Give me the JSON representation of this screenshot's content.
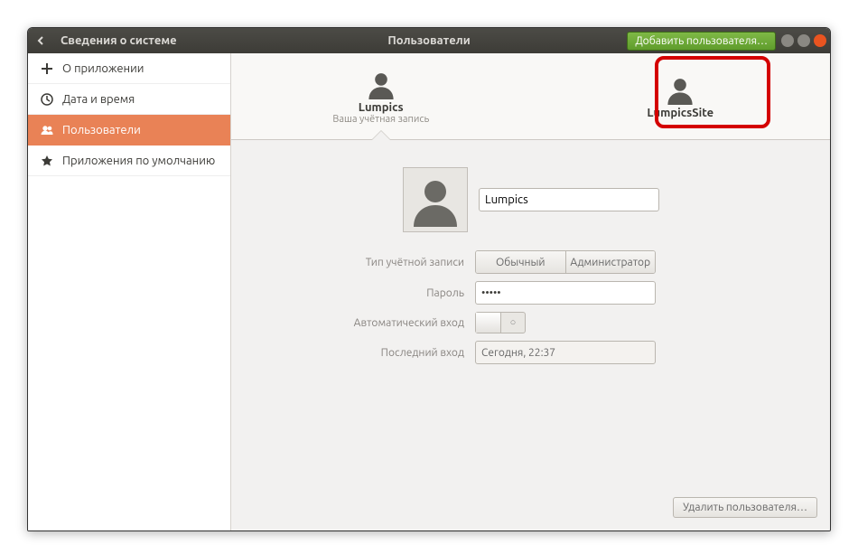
{
  "titlebar": {
    "back_label": "Сведения о системе",
    "center_title": "Пользователи",
    "add_user_label": "Добавить пользователя…"
  },
  "sidebar": {
    "items": [
      {
        "label": "О приложении"
      },
      {
        "label": "Дата и время"
      },
      {
        "label": "Пользователи"
      },
      {
        "label": "Приложения по умолчанию"
      }
    ]
  },
  "user_tabs": [
    {
      "name": "Lumpics",
      "sub": "Ваша учётная запись",
      "active": true
    },
    {
      "name": "LumpicsSite",
      "sub": "",
      "active": false
    }
  ],
  "form": {
    "name_value": "Lumpics",
    "account_type_label": "Тип учётной записи",
    "account_type_options": [
      "Обычный",
      "Администратор"
    ],
    "password_label": "Пароль",
    "password_value": "•••••",
    "autologin_label": "Автоматический вход",
    "autologin_off_glyph": "○",
    "last_login_label": "Последний вход",
    "last_login_value": "Сегодня, 22:37",
    "delete_label": "Удалить пользователя…"
  }
}
